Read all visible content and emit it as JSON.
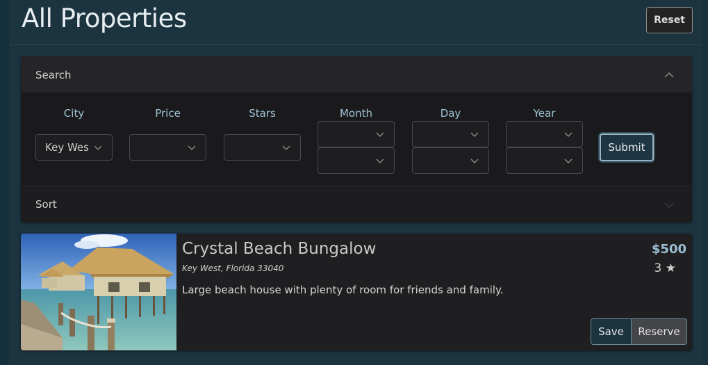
{
  "header": {
    "title": "All Properties",
    "reset_label": "Reset"
  },
  "search": {
    "label": "Search",
    "fields": {
      "city": {
        "label": "City",
        "value": "Key Wes"
      },
      "price": {
        "label": "Price",
        "value": ""
      },
      "stars": {
        "label": "Stars",
        "value": ""
      },
      "month": {
        "label": "Month",
        "value": ""
      },
      "day": {
        "label": "Day",
        "value": ""
      },
      "year": {
        "label": "Year",
        "value": ""
      }
    },
    "submit_label": "Submit"
  },
  "sort": {
    "label": "Sort"
  },
  "listing": {
    "name": "Crystal Beach Bungalow",
    "address": "Key West, Florida 33040",
    "description": "Large beach house with plenty of room for friends and family.",
    "price": "$500",
    "stars": "3 ★",
    "save_label": "Save",
    "reserve_label": "Reserve"
  },
  "colors": {
    "accent": "#9bbfd2",
    "header_bg": "#1c3340",
    "panel_bg": "#1f1f21"
  }
}
